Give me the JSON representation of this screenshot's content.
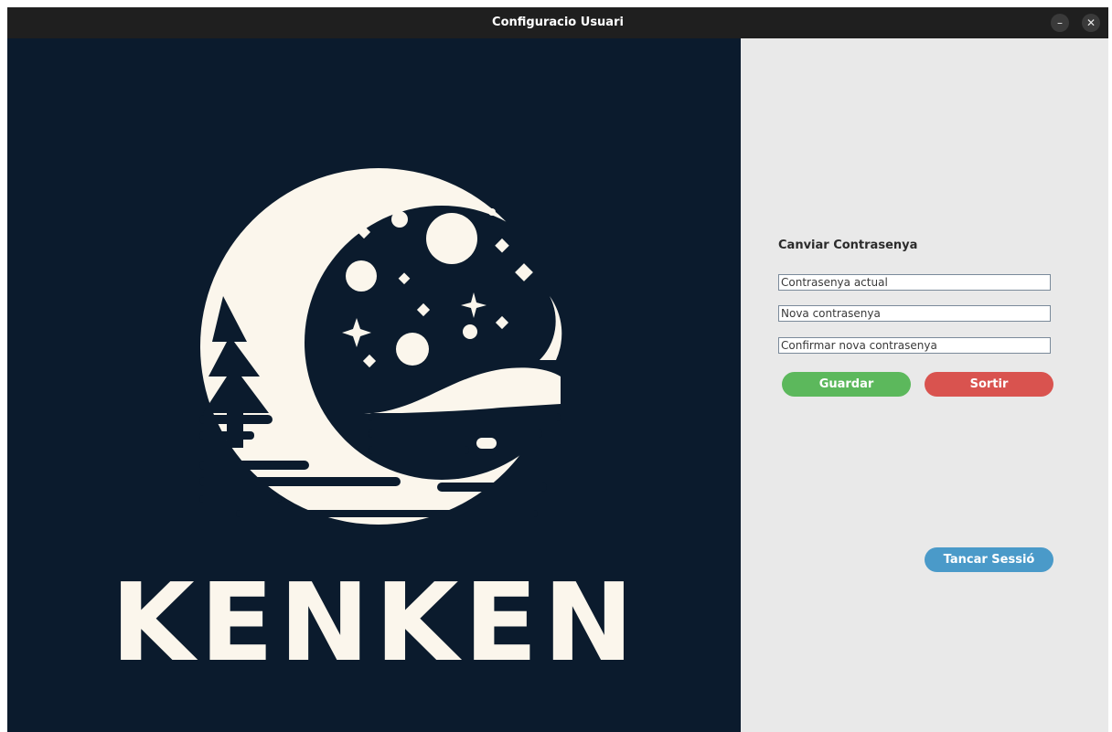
{
  "window": {
    "title": "Configuracio Usuari",
    "minimize_symbol": "–",
    "close_symbol": "✕"
  },
  "logo": {
    "text": "KENKEN",
    "background_color": "#0b1b2d",
    "foreground_color": "#fbf6ec"
  },
  "form": {
    "section_title": "Canviar Contrasenya",
    "current_password_placeholder": "Contrasenya actual",
    "new_password_placeholder": "Nova contrasenya",
    "confirm_password_placeholder": "Confirmar nova contrasenya",
    "save_label": "Guardar",
    "exit_label": "Sortir",
    "logout_label": "Tancar Sessió",
    "colors": {
      "save": "#5cb85c",
      "exit": "#d9534f",
      "logout": "#4a9ac9"
    }
  }
}
